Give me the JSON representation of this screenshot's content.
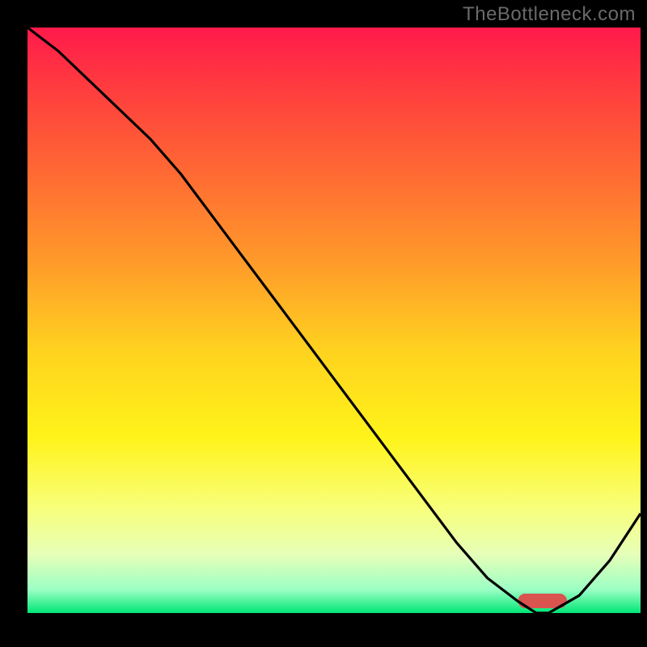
{
  "watermark": "TheBottleneck.com",
  "marker_color": "#d9544f",
  "chart_data": {
    "type": "line",
    "title": "",
    "xlabel": "",
    "ylabel": "",
    "xlim": [
      0,
      100
    ],
    "ylim": [
      0,
      100
    ],
    "x": [
      0,
      5,
      10,
      15,
      20,
      25,
      30,
      35,
      40,
      45,
      50,
      55,
      60,
      65,
      70,
      75,
      80,
      83,
      85,
      90,
      95,
      100
    ],
    "values": [
      100,
      96,
      91,
      86,
      81,
      75,
      68,
      61,
      54,
      47,
      40,
      33,
      26,
      19,
      12,
      6,
      2,
      0,
      0,
      3,
      9,
      17
    ],
    "optimum_range_x": [
      80,
      88
    ],
    "gradient_stops": [
      {
        "pos": 0.0,
        "color": "#ff1a4b"
      },
      {
        "pos": 0.1,
        "color": "#ff3b3f"
      },
      {
        "pos": 0.25,
        "color": "#ff6a33"
      },
      {
        "pos": 0.4,
        "color": "#ff9a2a"
      },
      {
        "pos": 0.55,
        "color": "#ffd21f"
      },
      {
        "pos": 0.7,
        "color": "#fff31a"
      },
      {
        "pos": 0.82,
        "color": "#f8ff7a"
      },
      {
        "pos": 0.9,
        "color": "#e6ffb8"
      },
      {
        "pos": 0.96,
        "color": "#9cffc4"
      },
      {
        "pos": 1.0,
        "color": "#00e676"
      }
    ]
  }
}
